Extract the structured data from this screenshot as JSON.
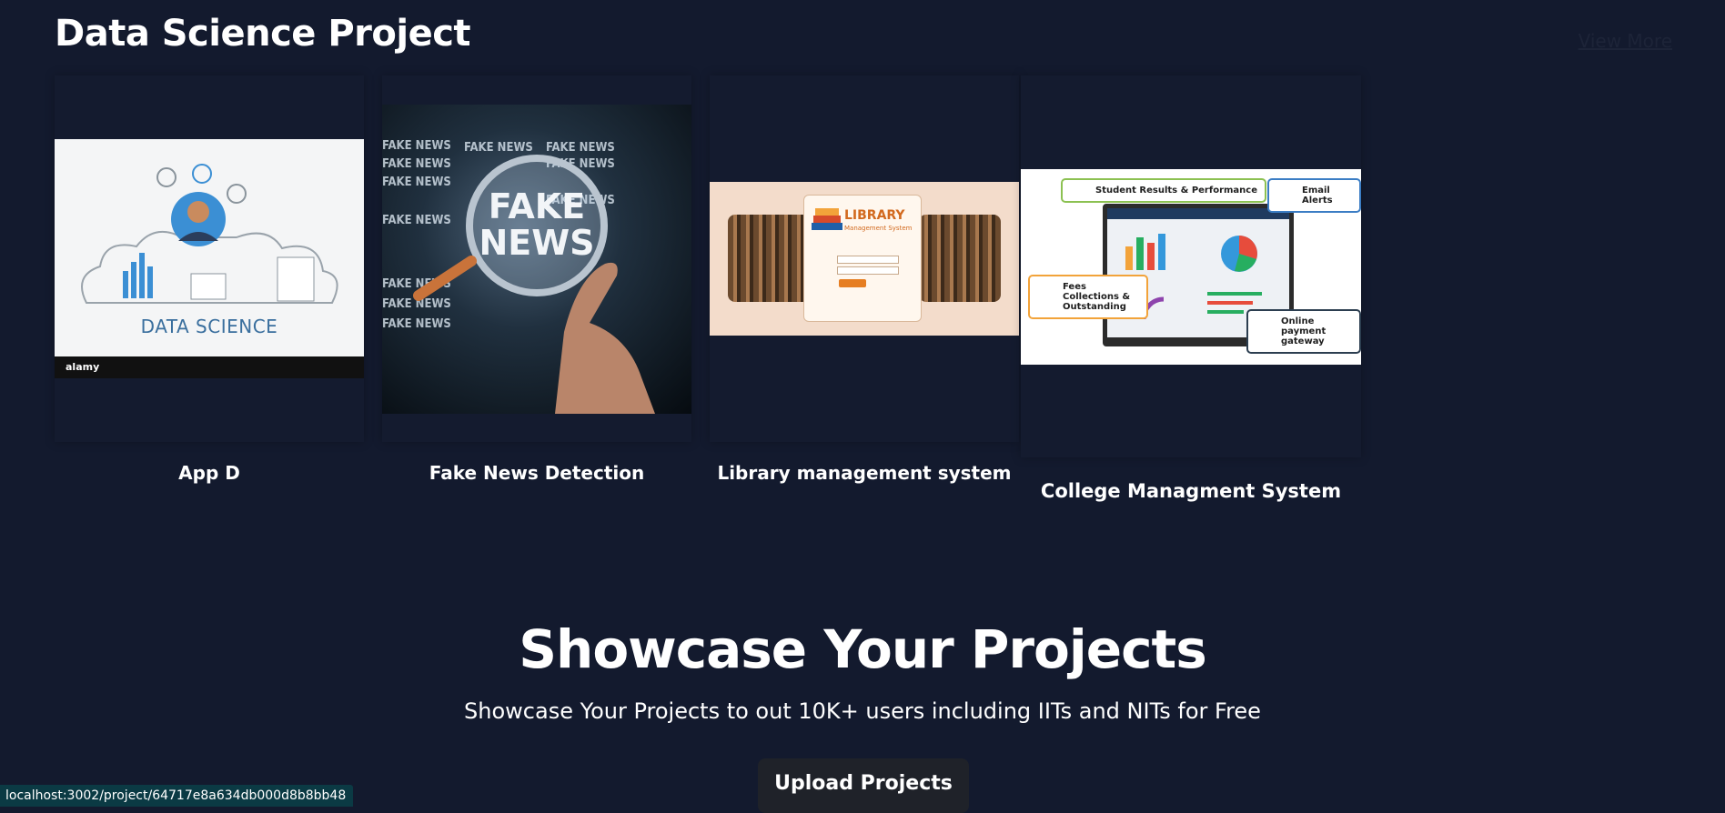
{
  "section": {
    "title": "Data Science Project",
    "view_more": "View More"
  },
  "cards": [
    {
      "title": "App D",
      "image": {
        "caption": "DATA SCIENCE",
        "watermark": "alamy"
      }
    },
    {
      "title": "Fake News Detection",
      "image": {
        "banner_text": "FAKE NEWS",
        "lens_line1": "FAKE",
        "lens_line2": "NEWS"
      }
    },
    {
      "title": "Library management system",
      "image": {
        "logo_line1": "LIBRARY",
        "logo_line2": "Management System"
      }
    },
    {
      "title": "College Managment System",
      "image": {
        "callout_results": "Student Results & Performance",
        "callout_email": "Email Alerts",
        "callout_fees": "Fees Collections & Outstanding",
        "callout_payment": "Online payment gateway"
      }
    }
  ],
  "hero": {
    "title": "Showcase Your Projects",
    "subtitle": "Showcase Your Projects to out 10K+ users including IITs and NITs for Free",
    "button_label": "Upload Projects"
  },
  "status_bar": {
    "url": "localhost:3002/project/64717e8a634db000d8b8bb48"
  },
  "colors": {
    "background": "#131a2e",
    "card_background": "#141b2f",
    "button_background": "#1f2229",
    "status_background": "#0b3a44"
  }
}
